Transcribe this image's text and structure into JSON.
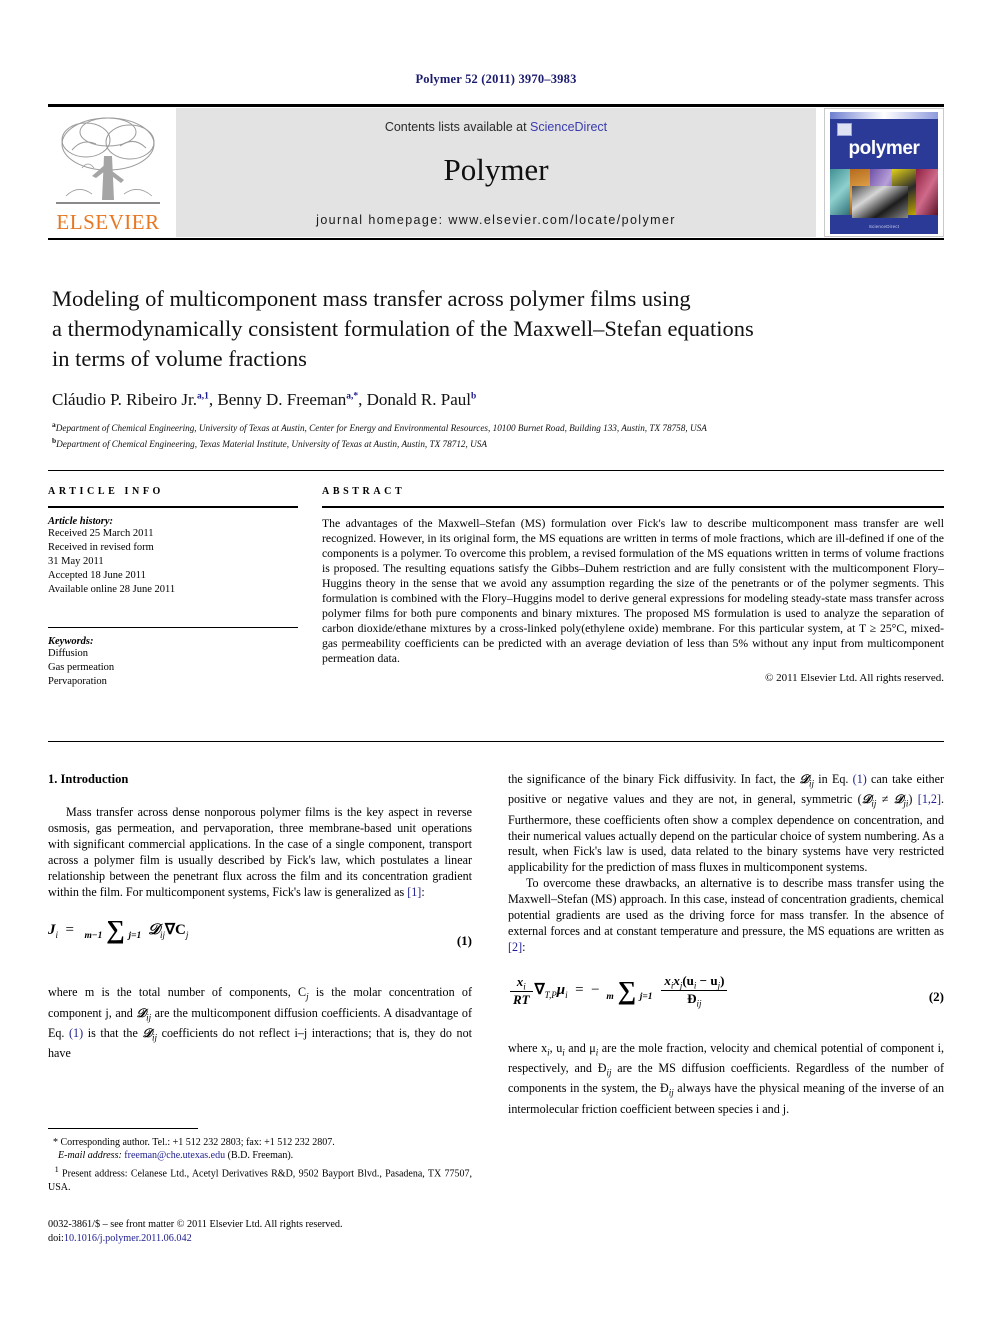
{
  "running_head": "Polymer 52 (2011) 3970–3983",
  "banner": {
    "contents_prefix": "Contents lists available at ",
    "sciencedirect": "ScienceDirect",
    "journal_title": "Polymer",
    "homepage": "journal homepage: www.elsevier.com/locate/polymer",
    "elsevier_wordmark": "ELSEVIER",
    "cover_wordmark": "polymer",
    "cover_footer": "ScienceDirect",
    "sciencedirect_color": "#3a3ab0",
    "elsevier_orange": "#E87722",
    "cover_blue": "#2b3a96"
  },
  "title": {
    "line1": "Modeling of multicomponent mass transfer across polymer films using",
    "line2": "a thermodynamically consistent formulation of the Maxwell–Stefan equations",
    "line3": "in terms of volume fractions"
  },
  "authors": {
    "a1_name": "Cláudio P. Ribeiro Jr.",
    "a1_sup": "a,1",
    "sep1": ", ",
    "a2_name": "Benny D. Freeman",
    "a2_sup": "a,*",
    "sep2": ", ",
    "a3_name": "Donald R. Paul",
    "a3_sup": "b"
  },
  "affiliations": [
    {
      "marker": "a",
      "text": "Department of Chemical Engineering, University of Texas at Austin, Center for Energy and Environmental Resources, 10100 Burnet Road, Building 133, Austin, TX 78758, USA"
    },
    {
      "marker": "b",
      "text": "Department of Chemical Engineering, Texas Material Institute, University of Texas at Austin, Austin, TX 78712, USA"
    }
  ],
  "article_info": {
    "heading": "ARTICLE INFO",
    "history_label": "Article history:",
    "history": [
      "Received 25 March 2011",
      "Received in revised form",
      "31 May 2011",
      "Accepted 18 June 2011",
      "Available online 28 June 2011"
    ],
    "keywords_label": "Keywords:",
    "keywords": [
      "Diffusion",
      "Gas permeation",
      "Pervaporation"
    ]
  },
  "abstract": {
    "heading": "ABSTRACT",
    "text": "The advantages of the Maxwell–Stefan (MS) formulation over Fick's law to describe multicomponent mass transfer are well recognized. However, in its original form, the MS equations are written in terms of mole fractions, which are ill-defined if one of the components is a polymer. To overcome this problem, a revised formulation of the MS equations written in terms of volume fractions is proposed. The resulting equations satisfy the Gibbs–Duhem restriction and are fully consistent with the multicomponent Flory–Huggins theory in the sense that we avoid any assumption regarding the size of the penetrants or of the polymer segments. This formulation is combined with the Flory–Huggins model to derive general expressions for modeling steady-state mass transfer across polymer films for both pure components and binary mixtures. The proposed MS formulation is used to analyze the separation of carbon dioxide/ethane mixtures by a cross-linked poly(ethylene oxide) membrane. For this particular system, at T ≥ 25°C, mixed-gas permeability coefficients can be predicted with an average deviation of less than 5% without any input from multicomponent permeation data.",
    "copyright": "© 2011 Elsevier Ltd. All rights reserved."
  },
  "body": {
    "section_heading": "1. Introduction",
    "left_para_1_a": "Mass transfer across dense nonporous polymer films is the key aspect in reverse osmosis, gas permeation, and pervaporation, three membrane-based unit operations with significant commercial applications. In the case of a single component, transport across a polymer film is usually described by Fick's law, which postulates a linear relationship between the penetrant flux across the film and its concentration gradient within the film. For multicomponent systems, Fick's law is generalized as ",
    "left_para_1_ref": "[1]",
    "left_para_1_b": ":",
    "left_para_2_a": "where m is the total number of components, C",
    "left_para_2_b": " is the molar concentration of component j, and ",
    "left_para_2_c": " are the multicomponent diffusion coefficients. A disadvantage of Eq. ",
    "left_para_2_ref": "(1)",
    "left_para_2_d": " is that the ",
    "left_para_2_e": " coefficients do not reflect i–j interactions; that is, they do not have",
    "right_para_1_a": "the significance of the binary Fick diffusivity. In fact, the ",
    "right_para_1_b": " in Eq. ",
    "right_para_1_ref1": "(1)",
    "right_para_1_c": " can take either positive or negative values and they are not, in general, symmetric (",
    "right_para_1_d": ") ",
    "right_para_1_ref2": "[1,2]",
    "right_para_1_e": ". Furthermore, these coefficients often show a complex dependence on concentration, and their numerical values actually depend on the particular choice of system numbering. As a result, when Fick's law is used, data related to the binary systems have very restricted applicability for the prediction of mass fluxes in multicomponent systems.",
    "right_para_2_a": "To overcome these drawbacks, an alternative is to describe mass transfer using the Maxwell–Stefan (MS) approach. In this case, instead of concentration gradients, chemical potential gradients are used as the driving force for mass transfer. In the absence of external forces and at constant temperature and pressure, the MS equations are written as ",
    "right_para_2_ref": "[2]",
    "right_para_2_b": ":",
    "right_para_3_a": "where x",
    "right_para_3_b": ", u",
    "right_para_3_c": " and μ",
    "right_para_3_d": " are the mole fraction, velocity and chemical potential of component i, respectively, and Ð",
    "right_para_3_e": " are the MS diffusion coefficients. Regardless of the number of components in the system, the Ð",
    "right_para_3_f": " always have the physical meaning of the inverse of an intermolecular friction coefficient between species i and j."
  },
  "equations": {
    "eq1": {
      "number": "(1)",
      "lhs": "J",
      "lhs_sub": "i",
      "eq": "=",
      "sum_top": "m−1",
      "sum_bot": "j=1",
      "term": "𝒟",
      "term_sub": "ij",
      "nabla": "∇C",
      "nabla_sub": "j"
    },
    "eq2": {
      "number": "(2)",
      "frac_num": "x",
      "frac_num_sub": "i",
      "frac_den": "RT",
      "grad": "∇",
      "grad_sub": "T,P",
      "mu": "μ",
      "mu_sub": "i",
      "eq": "=",
      "minus": "−",
      "sum_top": "m",
      "sum_bot": "j=1",
      "rhs_num_a": "x",
      "rhs_num_a_sub": "i",
      "rhs_num_b": "x",
      "rhs_num_b_sub": "j",
      "rhs_num_c": "(u",
      "rhs_num_c_sub": "i",
      "rhs_num_d": " − u",
      "rhs_num_d_sub": "j",
      "rhs_num_e": ")",
      "rhs_den": "Ð",
      "rhs_den_sub": "ij"
    }
  },
  "footnotes": {
    "star_marker": "*",
    "star_text": "Corresponding author. Tel.: +1 512 232 2803; fax: +1 512 232 2807.",
    "email_label": "E-mail address:",
    "email": "freeman@che.utexas.edu",
    "email_owner": "(B.D. Freeman).",
    "one_marker": "1",
    "one_text": "Present address: Celanese Ltd., Acetyl Derivatives R&D, 9502 Bayport Blvd., Pasadena, TX 77507, USA."
  },
  "imprint": {
    "line1": "0032-3861/$ – see front matter © 2011 Elsevier Ltd. All rights reserved.",
    "doi_label": "doi:",
    "doi": "10.1016/j.polymer.2011.06.042"
  }
}
